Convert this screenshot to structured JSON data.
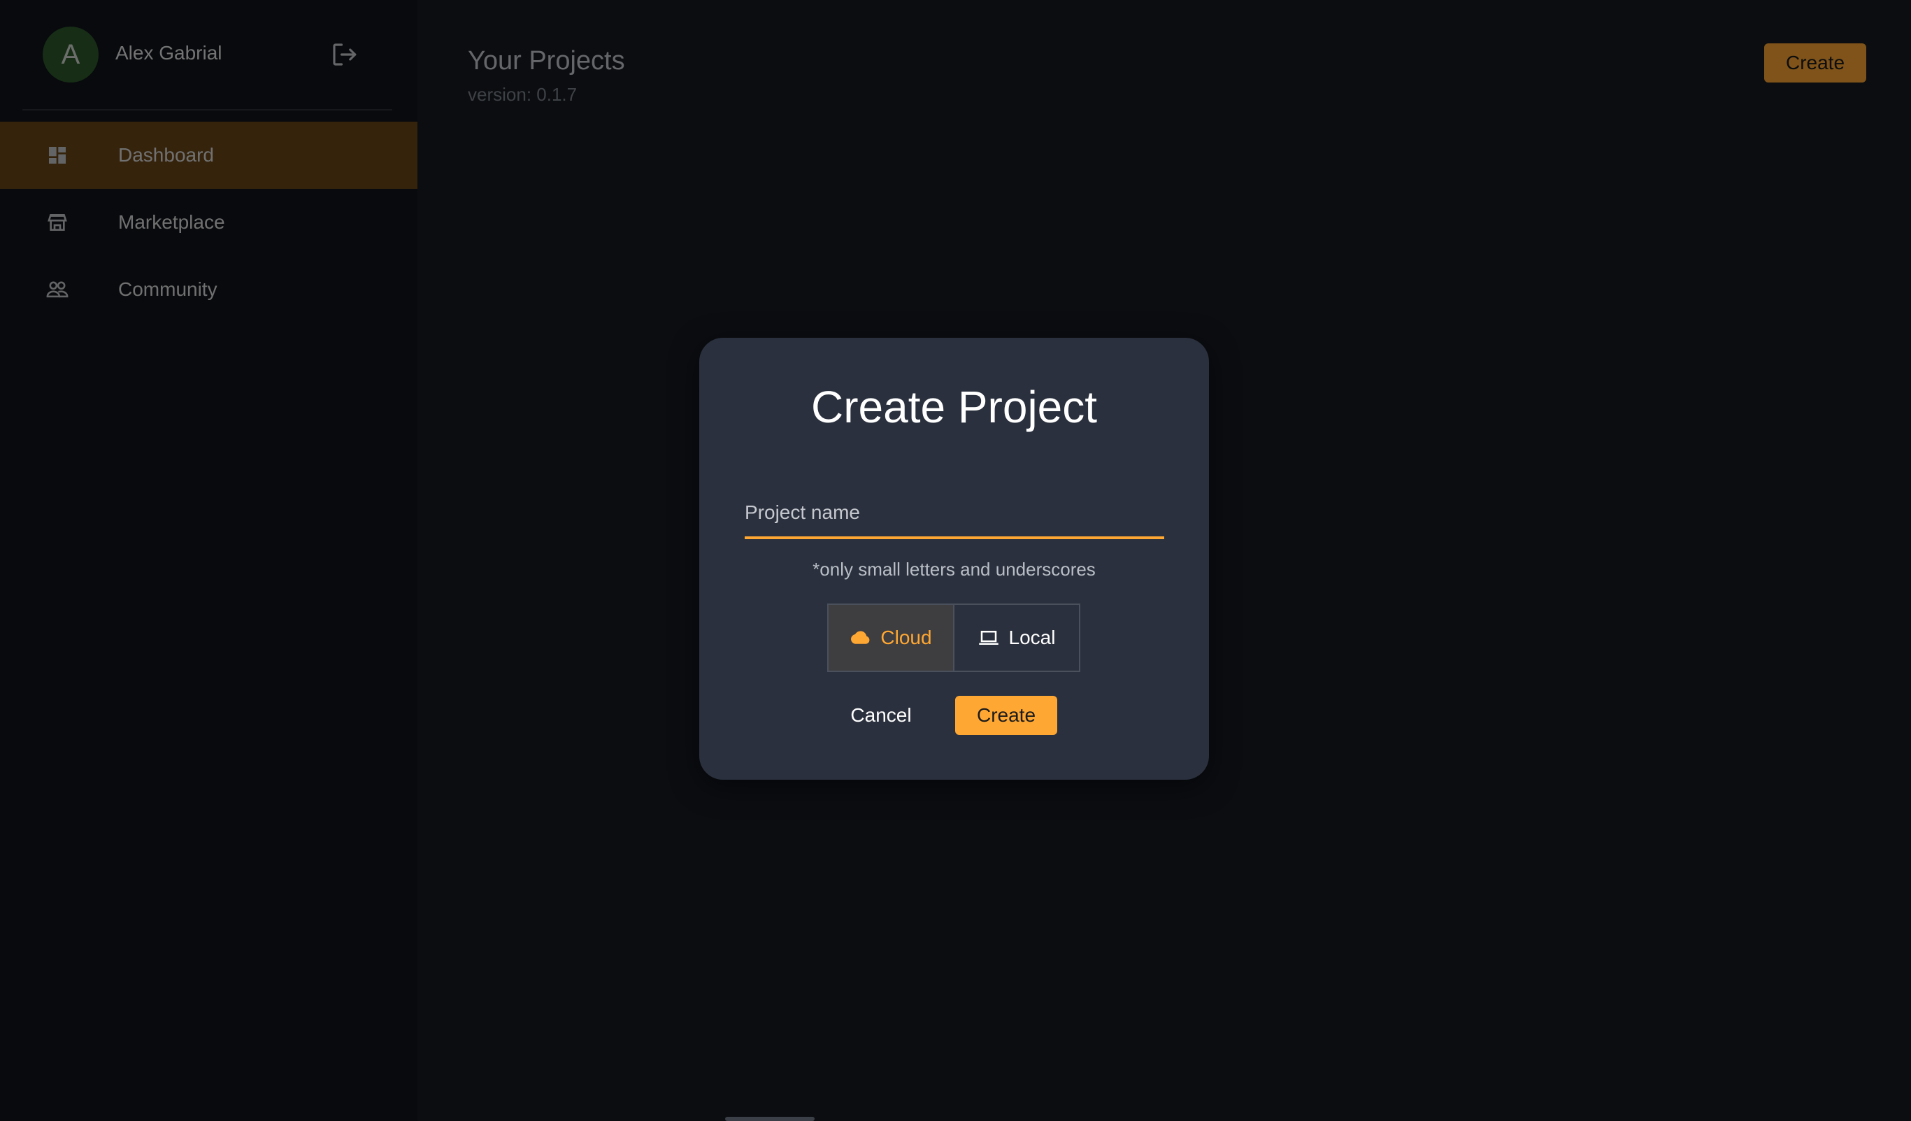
{
  "user": {
    "initial": "A",
    "name": "Alex Gabrial"
  },
  "sidebar": {
    "items": [
      {
        "label": "Dashboard",
        "icon": "dashboard-icon",
        "active": true
      },
      {
        "label": "Marketplace",
        "icon": "store-icon",
        "active": false
      },
      {
        "label": "Community",
        "icon": "people-icon",
        "active": false
      }
    ]
  },
  "main": {
    "title": "Your Projects",
    "version": "version: 0.1.7",
    "create_label": "Create"
  },
  "modal": {
    "title": "Create Project",
    "project_name_placeholder": "Project name",
    "project_name_value": "",
    "helper": "*only small letters and underscores",
    "location_options": [
      {
        "label": "Cloud",
        "icon": "cloud-icon",
        "selected": true
      },
      {
        "label": "Local",
        "icon": "laptop-icon",
        "selected": false
      }
    ],
    "cancel_label": "Cancel",
    "create_label": "Create"
  },
  "colors": {
    "accent": "#ffa733",
    "sidebar_active": "#6a4618",
    "modal_bg": "#2a303d",
    "avatar_bg": "#2f5a2d"
  }
}
